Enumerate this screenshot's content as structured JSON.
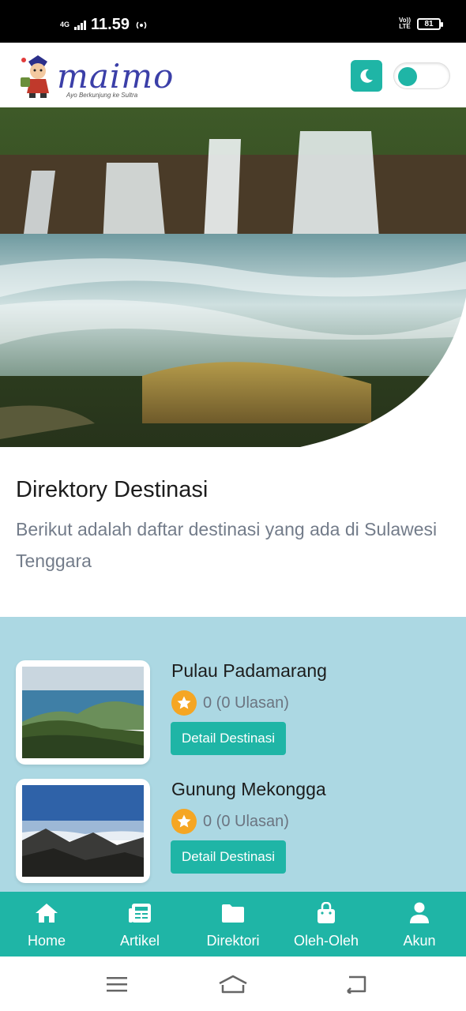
{
  "status_bar": {
    "network": "4G",
    "time": "11.59",
    "volte_top": "Vo))",
    "volte_bottom": "LTE",
    "battery": "81",
    "icons": [
      "signal-icon",
      "hotspot-icon",
      "volte-icon",
      "battery-icon"
    ]
  },
  "header": {
    "logo_text": "maimo",
    "logo_tagline": "Ayo Berkunjung ke Sultra",
    "theme_icon": "moon-icon",
    "toggle_state": "on"
  },
  "hero": {
    "image": "waterfall-photo"
  },
  "intro": {
    "title": "Direktory Destinasi",
    "description": "Berikut adalah daftar destinasi yang ada di Sulawesi Tenggara"
  },
  "destinations": [
    {
      "name": "Pulau Padamarang",
      "rating_text": "0 (0 Ulasan)",
      "button_label": "Detail Destinasi",
      "image": "island-photo"
    },
    {
      "name": "Gunung Mekongga",
      "rating_text": "0 (0 Ulasan)",
      "button_label": "Detail Destinasi",
      "image": "mountain-photo"
    }
  ],
  "bottom_nav": [
    {
      "label": "Home",
      "icon": "home-icon"
    },
    {
      "label": "Artikel",
      "icon": "newspaper-icon"
    },
    {
      "label": "Direktori",
      "icon": "folder-icon"
    },
    {
      "label": "Oleh-Oleh",
      "icon": "shopping-bag-icon"
    },
    {
      "label": "Akun",
      "icon": "user-icon"
    }
  ],
  "colors": {
    "accent": "#1fb5a6",
    "list_background": "#acd8e3",
    "star": "#f5a623"
  }
}
